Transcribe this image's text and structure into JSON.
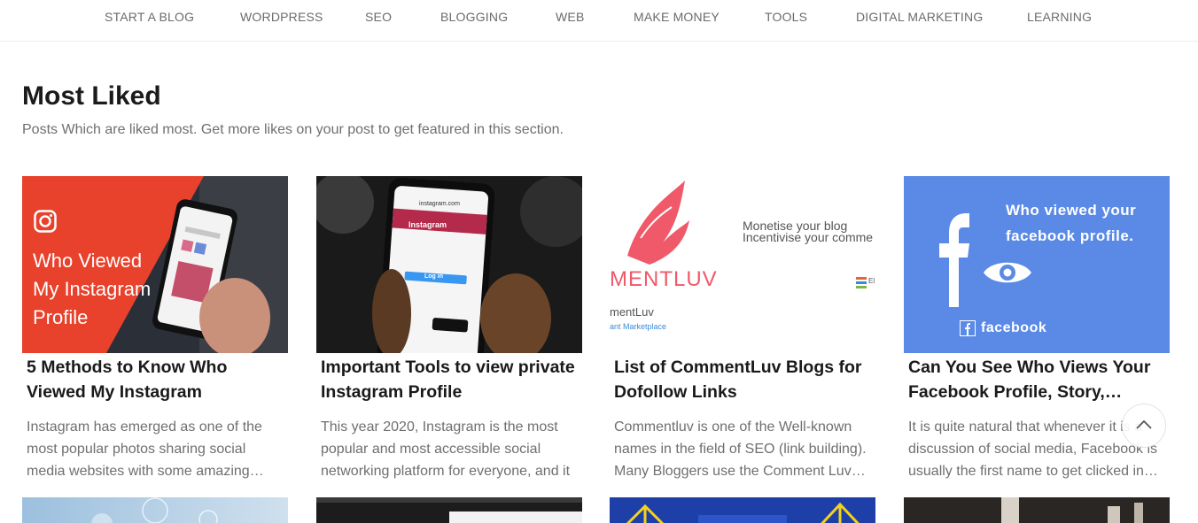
{
  "nav": {
    "items": [
      "START A BLOG",
      "WORDPRESS",
      "SEO",
      "BLOGGING",
      "WEB",
      "MAKE MONEY",
      "TOOLS",
      "DIGITAL MARKETING",
      "LEARNING"
    ]
  },
  "section": {
    "title": "Most Liked",
    "subtitle": "Posts Which are liked most. Get more likes on your post to get featured in this section."
  },
  "cards": [
    {
      "title": "5 Methods to Know Who Viewed My Instagram",
      "excerpt": "Instagram has emerged as one of the most popular photos sharing social media websites with some amazing features",
      "thumb": {
        "line1": "Who Viewed",
        "line2": "My Instagram",
        "line3": "Profile",
        "icon": "instagram-icon"
      }
    },
    {
      "title": "Important Tools to view private Instagram Profile",
      "excerpt": "This year 2020, Instagram is the most popular and most accessible social networking platform for everyone, and it",
      "thumb": {
        "screen_brand": "Instagram",
        "url": "instagram.com",
        "button": "Log in"
      }
    },
    {
      "title": "List of CommentLuv Blogs for Dofollow Links",
      "excerpt": "Commentluv is one of the Well-known names in the field of SEO (link building). Many Bloggers use the Comment Luv plugin",
      "thumb": {
        "logo": "MENTLUV",
        "tag1": "Monetise your blog",
        "tag2": "Incentivise your comme",
        "small1": "mentLuv",
        "small2": "ant Marketplace",
        "badge": "El"
      }
    },
    {
      "title": "Can You See Who Views Your Facebook Profile, Story, Videos?",
      "excerpt": "It is quite natural that whenever it is a discussion of social media, Facebook is usually the first name to get clicked in mind",
      "thumb": {
        "line1": "Who viewed your",
        "line2": "facebook profile.",
        "brand": "facebook",
        "icon": "facebook-icon"
      }
    }
  ],
  "colors": {
    "instagram_red": "#e8412c",
    "facebook_blue": "#5a8ae6",
    "commentluv_pink": "#f0596a"
  }
}
